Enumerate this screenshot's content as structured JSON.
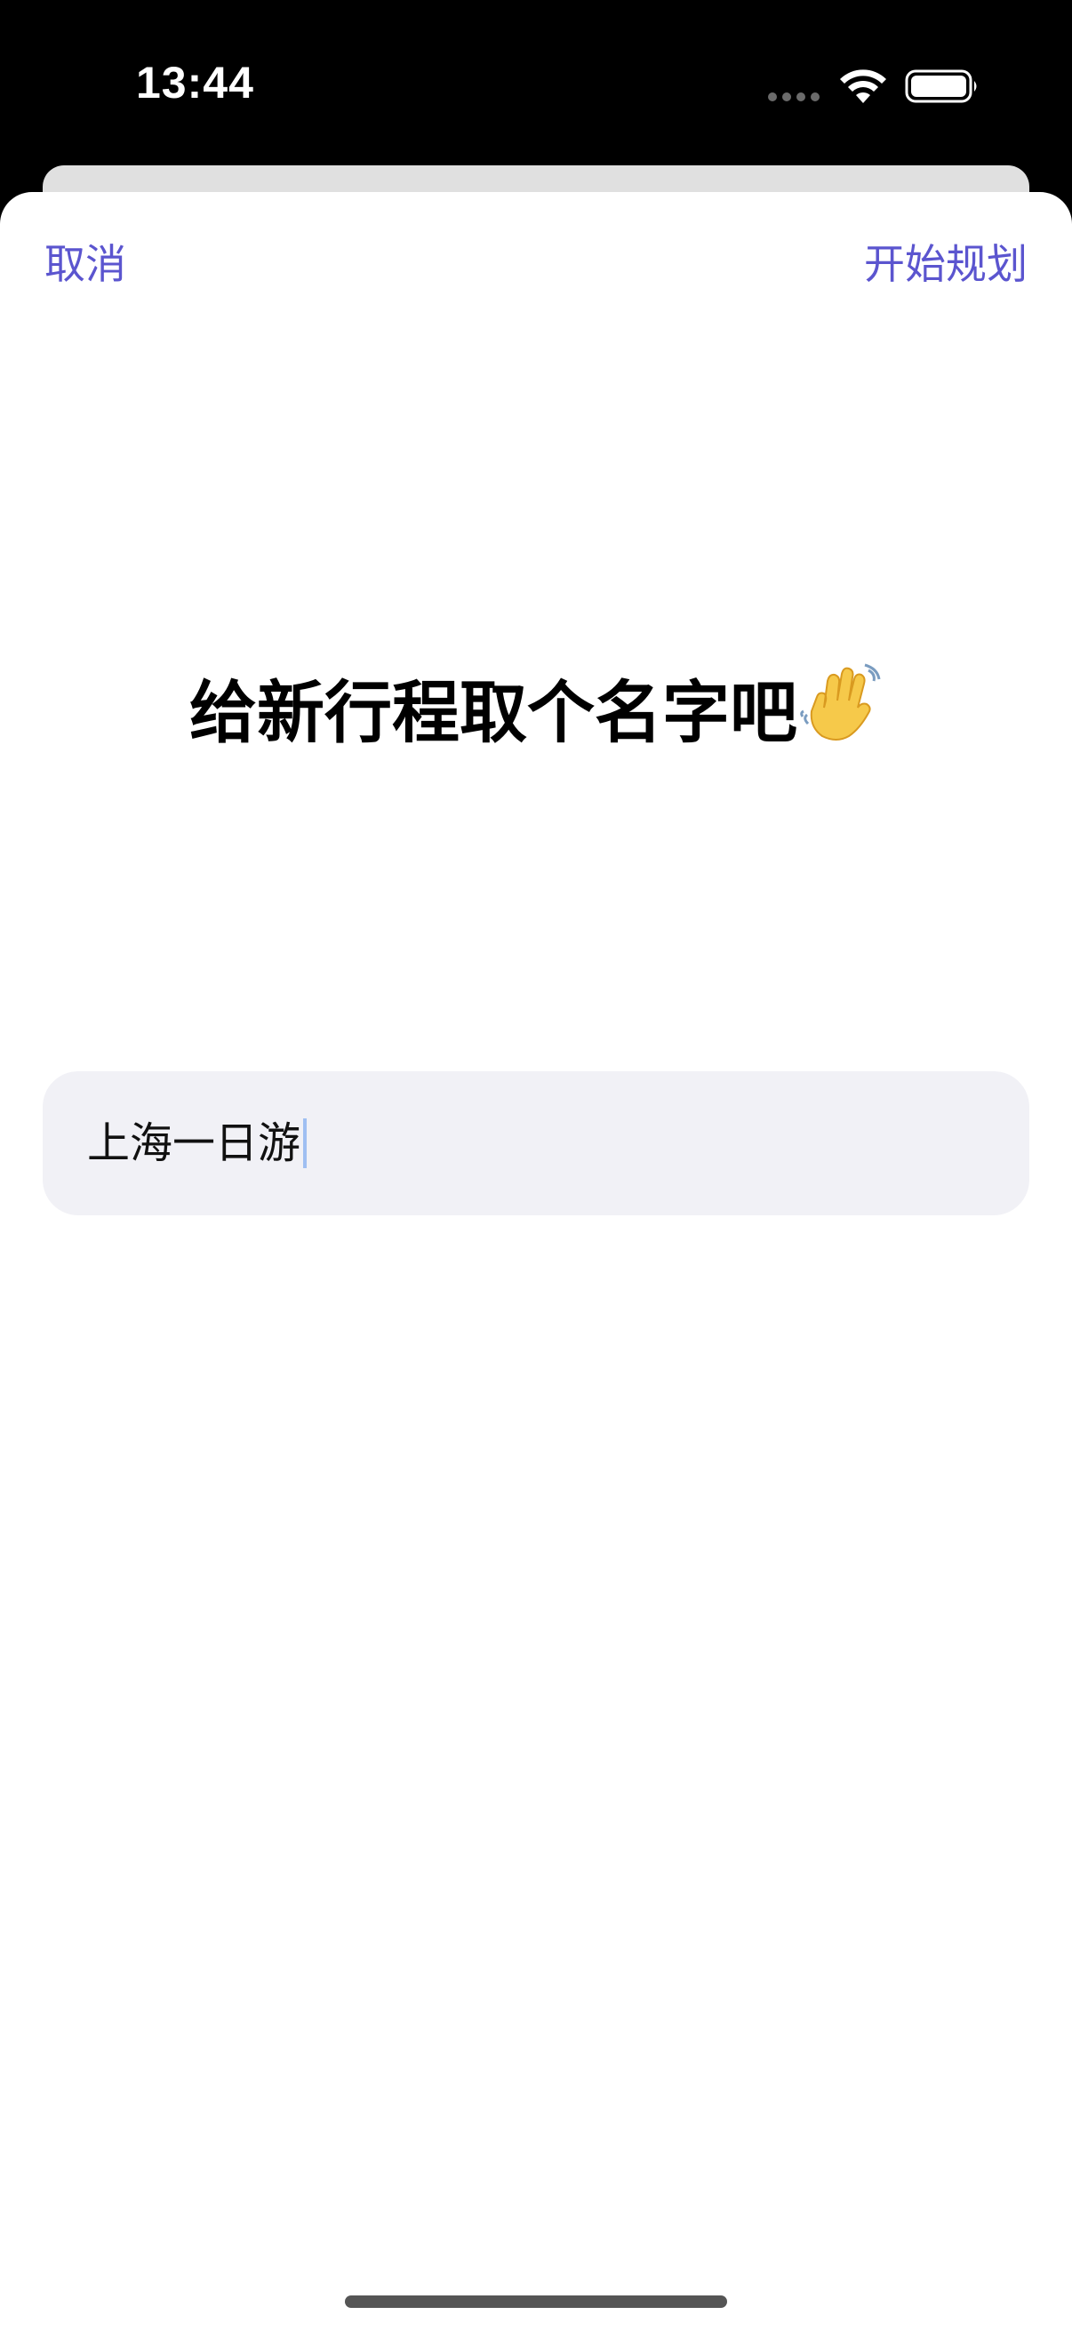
{
  "status_bar": {
    "time": "13:44",
    "wifi_icon": "wifi-icon",
    "battery_icon": "battery-icon"
  },
  "nav": {
    "cancel_label": "取消",
    "start_label": "开始规划"
  },
  "title": {
    "text": "给新行程取个名字吧",
    "emoji_icon": "waving-hand-icon"
  },
  "name_input": {
    "value": "上海一日游"
  },
  "colors": {
    "accent": "#5b55cf",
    "field_background": "#f1f1f6",
    "caret": "#9fbff2"
  }
}
